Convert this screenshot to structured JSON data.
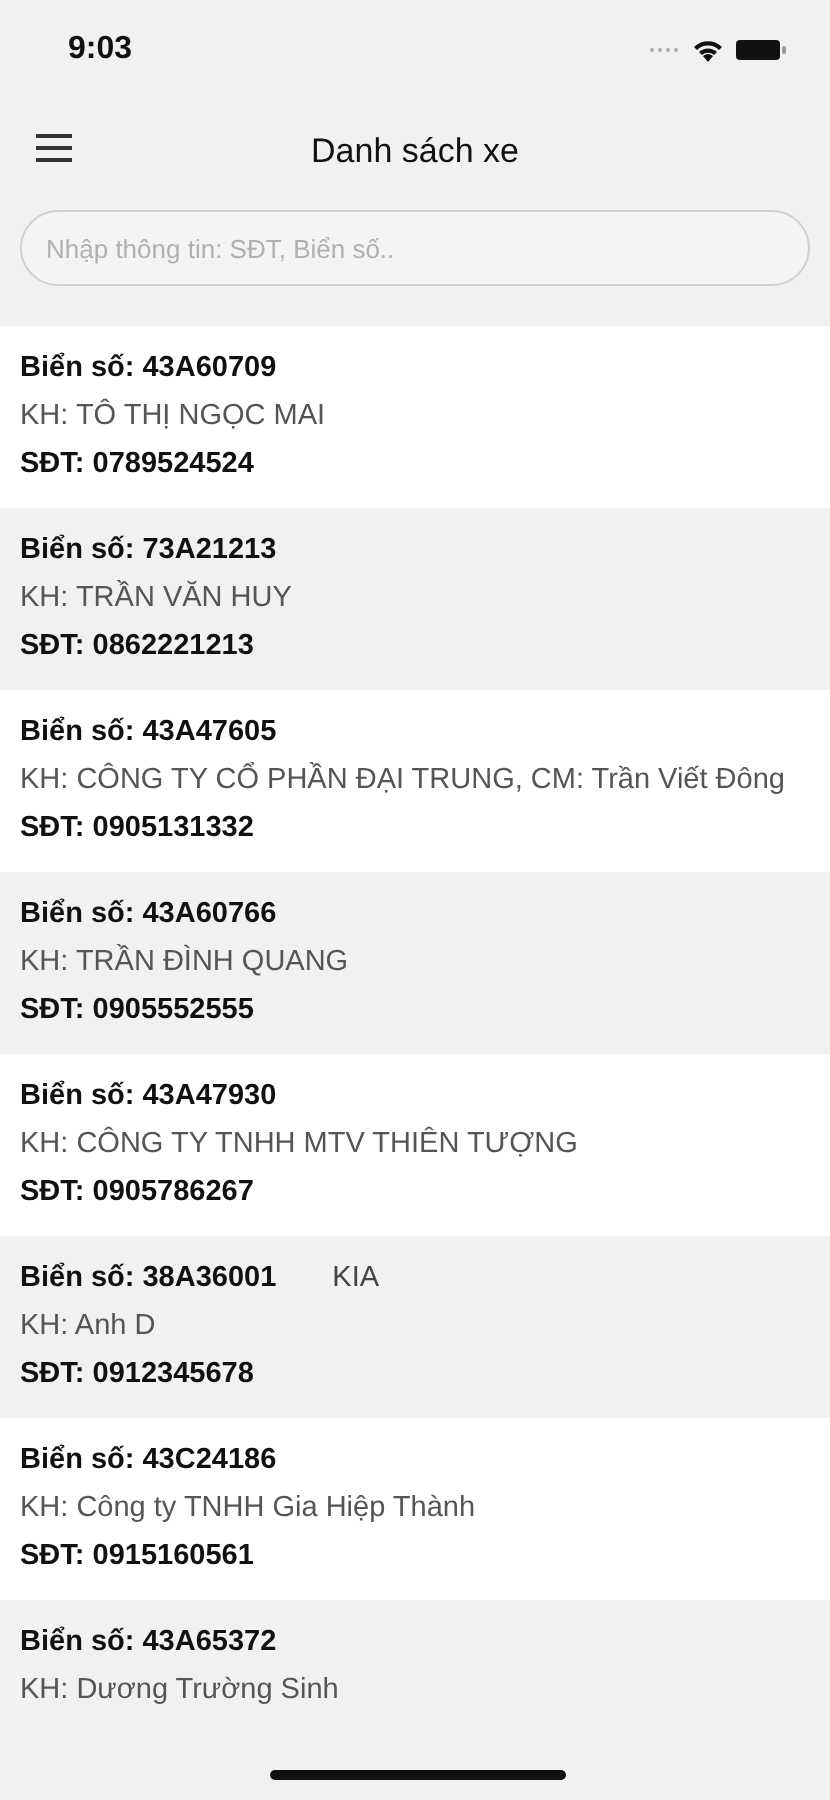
{
  "status_bar": {
    "time": "9:03"
  },
  "header": {
    "title": "Danh sách xe"
  },
  "search": {
    "placeholder": "Nhập thông tin: SĐT, Biển số.."
  },
  "vehicles": [
    {
      "plate": "Biển số: 43A60709",
      "customer": "KH: TÔ THỊ NGỌC MAI",
      "phone": "SĐT: 0789524524"
    },
    {
      "plate": "Biển số: 73A21213",
      "customer": "KH: TRẦN VĂN HUY",
      "phone": "SĐT: 0862221213"
    },
    {
      "plate": "Biển số: 43A47605",
      "customer": "KH: CÔNG TY CỔ PHẦN ĐẠI TRUNG, CM: Trần Viết Đông",
      "phone": "SĐT: 0905131332"
    },
    {
      "plate": "Biển số: 43A60766",
      "customer": "KH: TRẦN ĐÌNH QUANG",
      "phone": "SĐT: 0905552555"
    },
    {
      "plate": "Biển số: 43A47930",
      "customer": "KH: CÔNG TY TNHH MTV THIÊN TƯỢNG",
      "phone": "SĐT: 0905786267"
    },
    {
      "plate": "Biển số: 38A36001",
      "brand": "KIA",
      "customer": "KH: Anh D",
      "phone": "SĐT: 0912345678"
    },
    {
      "plate": "Biển số: 43C24186",
      "customer": "KH: Công ty TNHH Gia Hiệp Thành",
      "phone": "SĐT: 0915160561"
    },
    {
      "plate": "Biển số: 43A65372",
      "customer": "KH: Dương Trường Sinh"
    }
  ]
}
